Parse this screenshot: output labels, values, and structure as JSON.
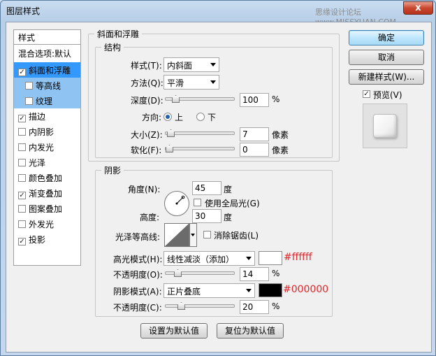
{
  "window": {
    "title": "图层样式",
    "watermark": "思缘设计论坛 www.MISSYUAN.COM",
    "close": "x"
  },
  "left_panel": {
    "header": "样式",
    "items": [
      {
        "label": "混合选项:默认",
        "checkbox": false,
        "checked": false
      },
      {
        "label": "斜面和浮雕",
        "checkbox": true,
        "checked": true
      },
      {
        "label": "等高线",
        "checkbox": true,
        "checked": false
      },
      {
        "label": "纹理",
        "checkbox": true,
        "checked": false
      },
      {
        "label": "描边",
        "checkbox": true,
        "checked": true
      },
      {
        "label": "内阴影",
        "checkbox": true,
        "checked": false
      },
      {
        "label": "内发光",
        "checkbox": true,
        "checked": false
      },
      {
        "label": "光泽",
        "checkbox": true,
        "checked": false
      },
      {
        "label": "颜色叠加",
        "checkbox": true,
        "checked": false
      },
      {
        "label": "渐变叠加",
        "checkbox": true,
        "checked": true
      },
      {
        "label": "图案叠加",
        "checkbox": true,
        "checked": false
      },
      {
        "label": "外发光",
        "checkbox": true,
        "checked": false
      },
      {
        "label": "投影",
        "checkbox": true,
        "checked": true
      }
    ]
  },
  "bevel": {
    "group_title": "斜面和浮雕",
    "structure_title": "结构",
    "style_label": "样式(T):",
    "style_value": "内斜面",
    "technique_label": "方法(Q):",
    "technique_value": "平滑",
    "depth_label": "深度(D):",
    "depth_value": "100",
    "depth_unit": "%",
    "direction_label": "方向:",
    "dir_up": "上",
    "dir_down": "下",
    "size_label": "大小(Z):",
    "size_value": "7",
    "size_unit": "像素",
    "soften_label": "软化(F):",
    "soften_value": "0",
    "soften_unit": "像素",
    "depth_level": 0.1,
    "size_level": 0.02,
    "soften_level": 0.0
  },
  "shading": {
    "title": "阴影",
    "angle_label": "角度(N):",
    "angle_value": "45",
    "angle_unit": "度",
    "global_light_label": "使用全局光(G)",
    "altitude_label": "高度:",
    "altitude_value": "30",
    "altitude_unit": "度",
    "gloss_label": "光泽等高线:",
    "antialias_label": "消除锯齿(L)",
    "highlight_mode_label": "高光模式(H):",
    "highlight_mode_value": "线性减淡（添加）",
    "highlight_color": "#ffffff",
    "highlight_hex_text": "#ffffff",
    "highlight_opacity_label": "不透明度(O):",
    "highlight_opacity_value": "14",
    "highlight_opacity_unit": "%",
    "shadow_mode_label": "阴影模式(A):",
    "shadow_mode_value": "正片叠底",
    "shadow_color": "#000000",
    "shadow_hex_text": "#000000",
    "shadow_opacity_label": "不透明度(C):",
    "shadow_opacity_value": "20",
    "shadow_opacity_unit": "%",
    "highlight_opacity_level": 0.14,
    "shadow_opacity_level": 0.2
  },
  "bottom": {
    "make_default": "设置为默认值",
    "reset_default": "复位为默认值"
  },
  "right": {
    "ok": "确定",
    "cancel": "取消",
    "new_style": "新建样式(W)...",
    "preview_label": "预览(V)"
  },
  "colors": {
    "selection": "#3399ff",
    "sub_selection": "#8fc3f2",
    "annotation": "#e0262a"
  }
}
